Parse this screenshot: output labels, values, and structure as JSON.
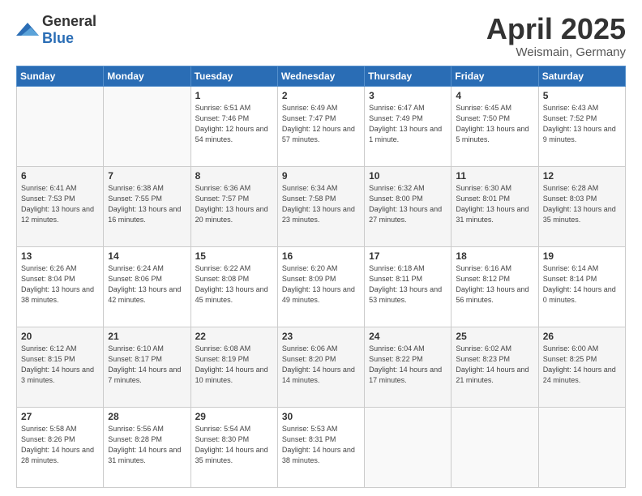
{
  "header": {
    "logo": {
      "general": "General",
      "blue": "Blue"
    },
    "title": "April 2025",
    "location": "Weismain, Germany"
  },
  "days_of_week": [
    "Sunday",
    "Monday",
    "Tuesday",
    "Wednesday",
    "Thursday",
    "Friday",
    "Saturday"
  ],
  "weeks": [
    [
      {
        "day": "",
        "info": ""
      },
      {
        "day": "",
        "info": ""
      },
      {
        "day": "1",
        "info": "Sunrise: 6:51 AM\nSunset: 7:46 PM\nDaylight: 12 hours\nand 54 minutes."
      },
      {
        "day": "2",
        "info": "Sunrise: 6:49 AM\nSunset: 7:47 PM\nDaylight: 12 hours\nand 57 minutes."
      },
      {
        "day": "3",
        "info": "Sunrise: 6:47 AM\nSunset: 7:49 PM\nDaylight: 13 hours\nand 1 minute."
      },
      {
        "day": "4",
        "info": "Sunrise: 6:45 AM\nSunset: 7:50 PM\nDaylight: 13 hours\nand 5 minutes."
      },
      {
        "day": "5",
        "info": "Sunrise: 6:43 AM\nSunset: 7:52 PM\nDaylight: 13 hours\nand 9 minutes."
      }
    ],
    [
      {
        "day": "6",
        "info": "Sunrise: 6:41 AM\nSunset: 7:53 PM\nDaylight: 13 hours\nand 12 minutes."
      },
      {
        "day": "7",
        "info": "Sunrise: 6:38 AM\nSunset: 7:55 PM\nDaylight: 13 hours\nand 16 minutes."
      },
      {
        "day": "8",
        "info": "Sunrise: 6:36 AM\nSunset: 7:57 PM\nDaylight: 13 hours\nand 20 minutes."
      },
      {
        "day": "9",
        "info": "Sunrise: 6:34 AM\nSunset: 7:58 PM\nDaylight: 13 hours\nand 23 minutes."
      },
      {
        "day": "10",
        "info": "Sunrise: 6:32 AM\nSunset: 8:00 PM\nDaylight: 13 hours\nand 27 minutes."
      },
      {
        "day": "11",
        "info": "Sunrise: 6:30 AM\nSunset: 8:01 PM\nDaylight: 13 hours\nand 31 minutes."
      },
      {
        "day": "12",
        "info": "Sunrise: 6:28 AM\nSunset: 8:03 PM\nDaylight: 13 hours\nand 35 minutes."
      }
    ],
    [
      {
        "day": "13",
        "info": "Sunrise: 6:26 AM\nSunset: 8:04 PM\nDaylight: 13 hours\nand 38 minutes."
      },
      {
        "day": "14",
        "info": "Sunrise: 6:24 AM\nSunset: 8:06 PM\nDaylight: 13 hours\nand 42 minutes."
      },
      {
        "day": "15",
        "info": "Sunrise: 6:22 AM\nSunset: 8:08 PM\nDaylight: 13 hours\nand 45 minutes."
      },
      {
        "day": "16",
        "info": "Sunrise: 6:20 AM\nSunset: 8:09 PM\nDaylight: 13 hours\nand 49 minutes."
      },
      {
        "day": "17",
        "info": "Sunrise: 6:18 AM\nSunset: 8:11 PM\nDaylight: 13 hours\nand 53 minutes."
      },
      {
        "day": "18",
        "info": "Sunrise: 6:16 AM\nSunset: 8:12 PM\nDaylight: 13 hours\nand 56 minutes."
      },
      {
        "day": "19",
        "info": "Sunrise: 6:14 AM\nSunset: 8:14 PM\nDaylight: 14 hours\nand 0 minutes."
      }
    ],
    [
      {
        "day": "20",
        "info": "Sunrise: 6:12 AM\nSunset: 8:15 PM\nDaylight: 14 hours\nand 3 minutes."
      },
      {
        "day": "21",
        "info": "Sunrise: 6:10 AM\nSunset: 8:17 PM\nDaylight: 14 hours\nand 7 minutes."
      },
      {
        "day": "22",
        "info": "Sunrise: 6:08 AM\nSunset: 8:19 PM\nDaylight: 14 hours\nand 10 minutes."
      },
      {
        "day": "23",
        "info": "Sunrise: 6:06 AM\nSunset: 8:20 PM\nDaylight: 14 hours\nand 14 minutes."
      },
      {
        "day": "24",
        "info": "Sunrise: 6:04 AM\nSunset: 8:22 PM\nDaylight: 14 hours\nand 17 minutes."
      },
      {
        "day": "25",
        "info": "Sunrise: 6:02 AM\nSunset: 8:23 PM\nDaylight: 14 hours\nand 21 minutes."
      },
      {
        "day": "26",
        "info": "Sunrise: 6:00 AM\nSunset: 8:25 PM\nDaylight: 14 hours\nand 24 minutes."
      }
    ],
    [
      {
        "day": "27",
        "info": "Sunrise: 5:58 AM\nSunset: 8:26 PM\nDaylight: 14 hours\nand 28 minutes."
      },
      {
        "day": "28",
        "info": "Sunrise: 5:56 AM\nSunset: 8:28 PM\nDaylight: 14 hours\nand 31 minutes."
      },
      {
        "day": "29",
        "info": "Sunrise: 5:54 AM\nSunset: 8:30 PM\nDaylight: 14 hours\nand 35 minutes."
      },
      {
        "day": "30",
        "info": "Sunrise: 5:53 AM\nSunset: 8:31 PM\nDaylight: 14 hours\nand 38 minutes."
      },
      {
        "day": "",
        "info": ""
      },
      {
        "day": "",
        "info": ""
      },
      {
        "day": "",
        "info": ""
      }
    ]
  ]
}
